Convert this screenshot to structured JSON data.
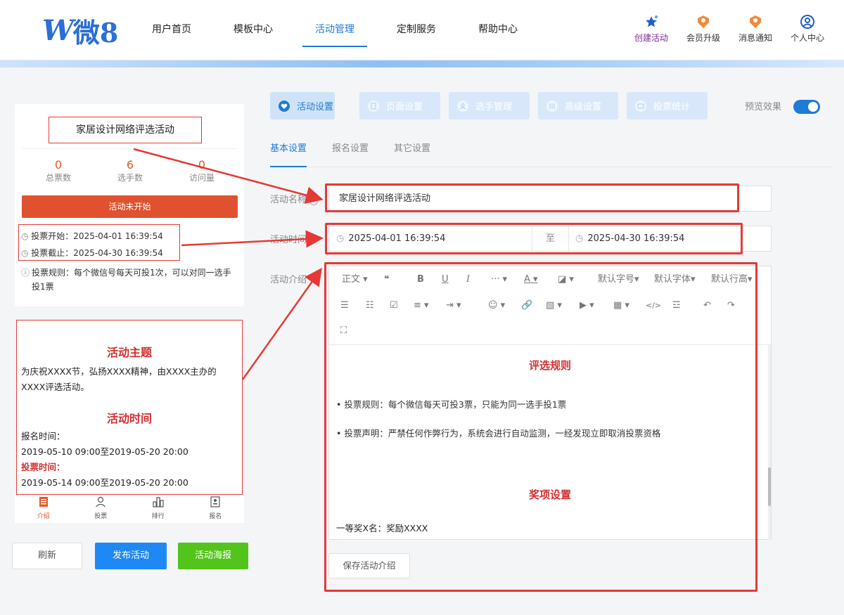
{
  "header": {
    "logo_w": "W",
    "logo_text": "微8",
    "nav": [
      {
        "label": "用户首页"
      },
      {
        "label": "模板中心"
      },
      {
        "label": "活动管理"
      },
      {
        "label": "定制服务"
      },
      {
        "label": "帮助中心"
      }
    ],
    "tools": [
      {
        "label": "创建活动",
        "icon": "star-icon"
      },
      {
        "label": "会员升级",
        "icon": "member-badge-icon"
      },
      {
        "label": "消息通知",
        "icon": "message-badge-icon"
      },
      {
        "label": "个人中心",
        "icon": "user-circle-icon"
      }
    ],
    "active_color": "#1e7bd8"
  },
  "preview": {
    "activity_title": "家居设计网络评选活动",
    "stats": [
      {
        "value": "0",
        "label": "总票数"
      },
      {
        "value": "6",
        "label": "选手数"
      },
      {
        "value": "0",
        "label": "访问量"
      }
    ],
    "status": "活动未开始",
    "vote_start": "投票开始：2025-04-01 16:39:54",
    "vote_end": "投票截止：2025-04-30 16:39:54",
    "rule": "投票规则：每个微信号每天可投1次，可以对同一选手投1票",
    "intro": {
      "theme_heading": "活动主题",
      "theme_text": "为庆祝XXXX节，弘扬XXXX精神，由XXXX主办的XXXX评选活动。",
      "time_heading": "活动时间",
      "signup_label": "报名时间：",
      "signup_range": "2019-05-10 09:00至2019-05-20 20:00",
      "vote_label": "投票时间：",
      "vote_range": "2019-05-14 09:00至2019-05-20 20:00"
    },
    "bottom_nav": [
      {
        "label": "介绍",
        "icon": "intro-icon"
      },
      {
        "label": "投票",
        "icon": "user-icon"
      },
      {
        "label": "排行",
        "icon": "ranking-icon"
      },
      {
        "label": "报名",
        "icon": "signup-icon"
      }
    ],
    "buttons": {
      "refresh": "刷新",
      "publish": "发布活动",
      "poster": "活动海报"
    }
  },
  "settings": {
    "tabs": [
      {
        "label": "活动设置",
        "icon": "heart-icon"
      },
      {
        "label": "页面设置",
        "icon": "page-icon"
      },
      {
        "label": "选手管理",
        "icon": "user-icon"
      },
      {
        "label": "高级设置",
        "icon": "advanced-icon"
      },
      {
        "label": "投票统计",
        "icon": "stats-icon"
      }
    ],
    "preview_label": "预览效果",
    "subtabs": [
      {
        "label": "基本设置"
      },
      {
        "label": "报名设置"
      },
      {
        "label": "其它设置"
      }
    ],
    "fields": {
      "name_label": "活动名称",
      "name_value": "家居设计网络评选活动",
      "time_label": "活动时间",
      "start": "2025-04-01 16:39:54",
      "to": "至",
      "end": "2025-04-30 16:39:54",
      "intro_label": "活动介绍"
    },
    "toolbar": {
      "paragraph": "正文",
      "font_size": "默认字号",
      "font_family": "默认字体",
      "line_height": "默认行高"
    },
    "editor": {
      "rules_heading": "评选规则",
      "bullet1": "投票规则：每个微信每天可投3票，只能为同一选手投1票",
      "bullet2": "投票声明：严禁任何作弊行为，系统会进行自动监测，一经发现立即取消投票资格",
      "awards_heading": "奖项设置",
      "first_prize": "一等奖X名：奖励XXXX"
    },
    "save_button": "保存活动介绍"
  }
}
